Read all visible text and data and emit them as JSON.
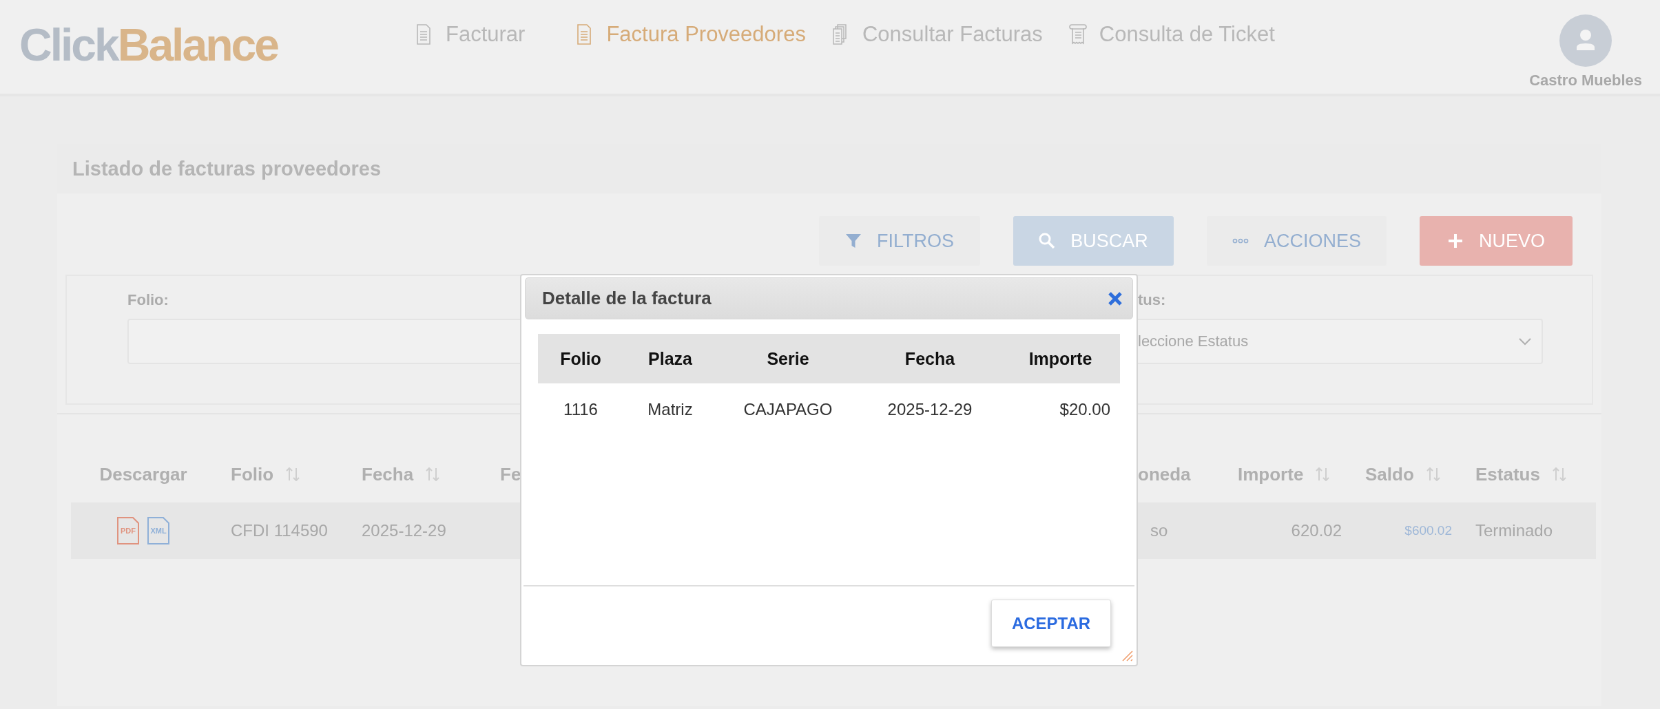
{
  "header": {
    "logo": [
      {
        "text": "Click",
        "color": "#b4bcc6"
      },
      {
        "text": "Balance",
        "color": "#d9b58a"
      }
    ],
    "nav": [
      {
        "label": "Facturar",
        "selected": false
      },
      {
        "label": "Factura Proveedores",
        "selected": true
      },
      {
        "label": "Consultar Facturas",
        "selected": false
      },
      {
        "label": "Consulta de Ticket",
        "selected": false
      }
    ],
    "user": "Castro Muebles"
  },
  "panel": {
    "title": "Listado de facturas proveedores",
    "buttons": [
      {
        "label": "FILTROS",
        "kind": "filter"
      },
      {
        "label": "BUSCAR",
        "kind": "search"
      },
      {
        "label": "ACCIONES",
        "kind": "actions"
      },
      {
        "label": "NUEVO",
        "kind": "new"
      }
    ],
    "filters": [
      {
        "label": "Folio:",
        "kind": "text"
      },
      {
        "label": "tus:",
        "kind": "select",
        "placeholder": "leccione Estatus"
      }
    ]
  },
  "table": {
    "columns": [
      {
        "label": "Descargar",
        "sortable": false
      },
      {
        "label": "Folio",
        "sortable": true
      },
      {
        "label": "Fecha",
        "sortable": true
      },
      {
        "label": "Fe",
        "sortable": false
      },
      {
        "label": "oneda",
        "sortable": false
      },
      {
        "label": "Importe",
        "sortable": true
      },
      {
        "label": "Saldo",
        "sortable": true
      },
      {
        "label": "Estatus",
        "sortable": true
      }
    ],
    "rows": [
      {
        "cells": [
          {
            "downloads": [
              {
                "label": "PDF",
                "kind": "pdf"
              },
              {
                "label": "XML",
                "kind": "xml"
              }
            ]
          },
          "CFDI 114590",
          "2025-12-29",
          "",
          "so",
          "620.02",
          "$600.02",
          "Terminado"
        ]
      }
    ]
  },
  "modal": {
    "title": "Detalle de la factura",
    "columns": [
      "Folio",
      "Plaza",
      "Serie",
      "Fecha",
      "Importe"
    ],
    "rows": [
      [
        "1116",
        "Matriz",
        "CAJAPAGO",
        "2025-12-29",
        "$20.00"
      ]
    ],
    "button": "ACEPTAR"
  }
}
